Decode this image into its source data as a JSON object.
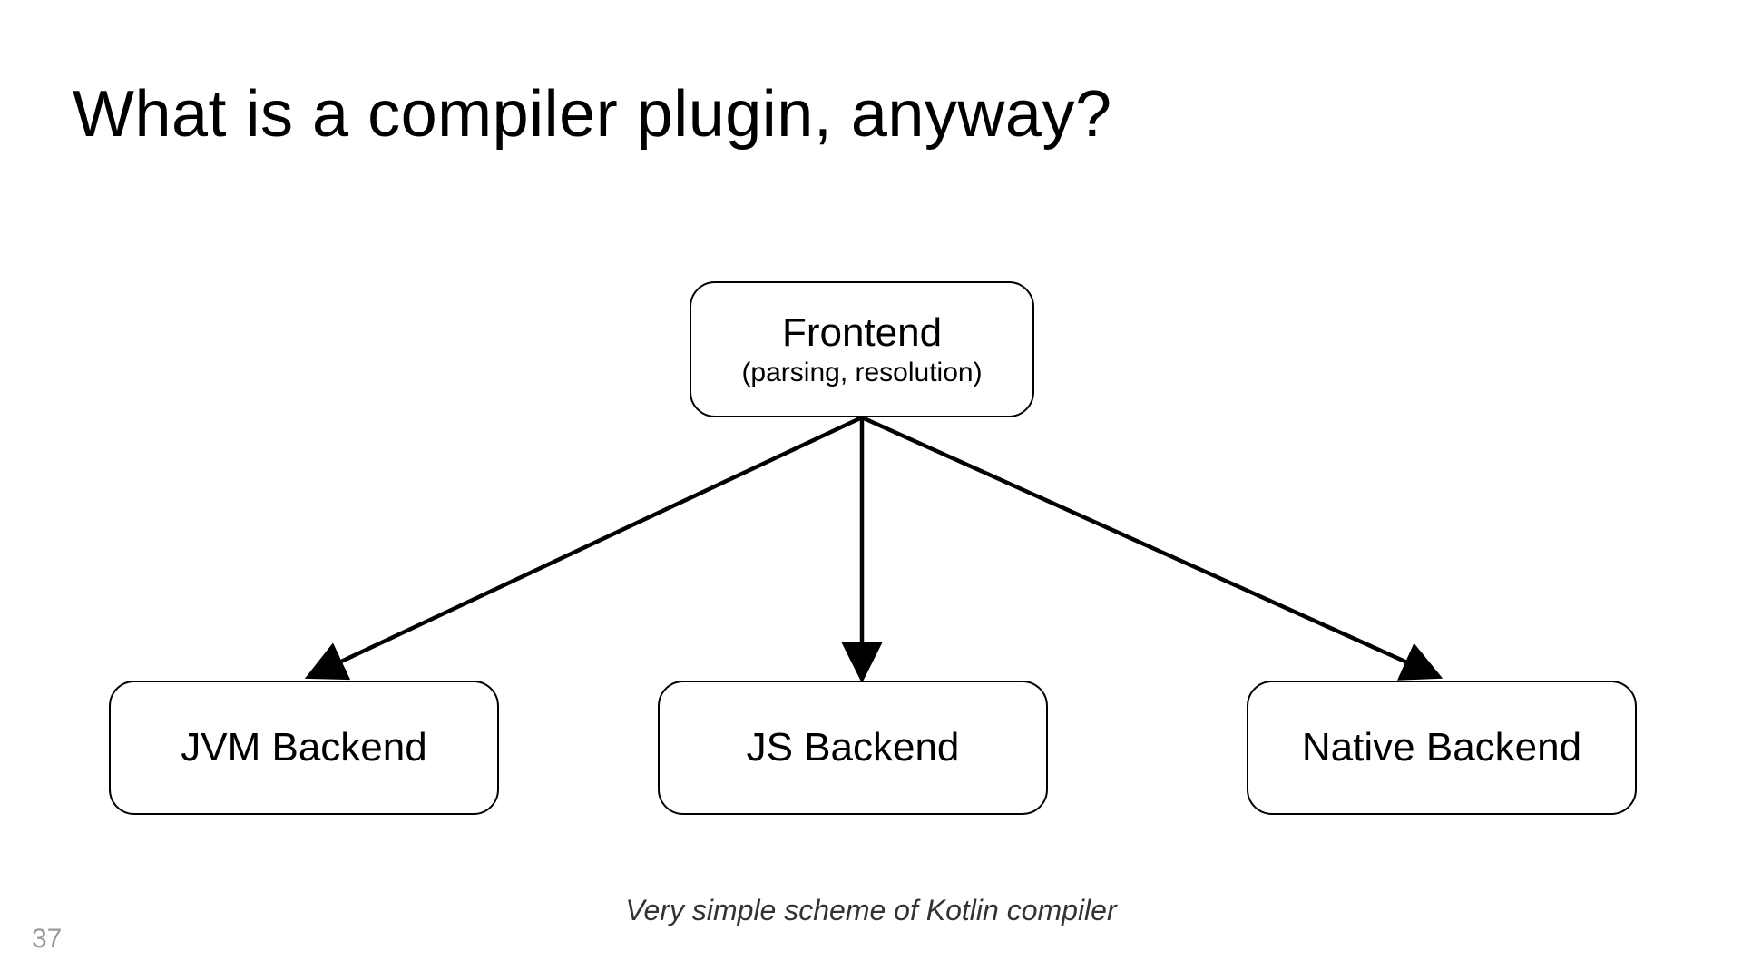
{
  "title": "What is a compiler plugin, anyway?",
  "diagram": {
    "frontend": {
      "label": "Frontend",
      "sublabel": "(parsing, resolution)"
    },
    "backends": {
      "jvm": "JVM Backend",
      "js": "JS Backend",
      "native": "Native Backend"
    }
  },
  "caption": "Very simple scheme of Kotlin compiler",
  "page_number": "37"
}
